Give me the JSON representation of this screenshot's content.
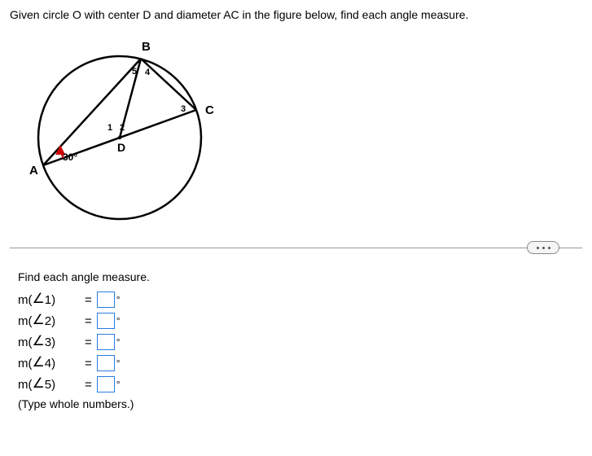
{
  "prompt": "Given circle O with center D and diameter AC in the figure below, find each angle measure.",
  "figure": {
    "labels": {
      "A": "A",
      "B": "B",
      "C": "C",
      "D": "D",
      "ang1": "1",
      "ang2": "2",
      "ang3": "3",
      "ang4": "4",
      "ang5": "5",
      "given": "30°"
    }
  },
  "answers": {
    "heading": "Find each angle measure.",
    "rows": [
      {
        "label_prefix": "m(",
        "angle": "∠",
        "num": "1",
        "label_suffix": ")",
        "value": ""
      },
      {
        "label_prefix": "m(",
        "angle": "∠",
        "num": "2",
        "label_suffix": ")",
        "value": ""
      },
      {
        "label_prefix": "m(",
        "angle": "∠",
        "num": "3",
        "label_suffix": ")",
        "value": ""
      },
      {
        "label_prefix": "m(",
        "angle": "∠",
        "num": "4",
        "label_suffix": ")",
        "value": ""
      },
      {
        "label_prefix": "m(",
        "angle": "∠",
        "num": "5",
        "label_suffix": ")",
        "value": ""
      }
    ],
    "equals": "=",
    "degree": "°",
    "hint": "(Type whole numbers.)"
  }
}
